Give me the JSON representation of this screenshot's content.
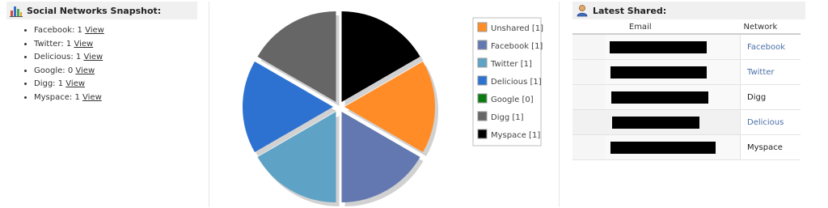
{
  "left_panel": {
    "title": "Social Networks Snapshot:",
    "icon": "bar-chart-icon",
    "items": [
      {
        "name": "Facebook:",
        "count": "1",
        "link": "View"
      },
      {
        "name": "Twitter:",
        "count": "1",
        "link": "View"
      },
      {
        "name": "Delicious:",
        "count": "1",
        "link": "View"
      },
      {
        "name": "Google:",
        "count": "0",
        "link": "View"
      },
      {
        "name": "Digg:",
        "count": "1",
        "link": "View"
      },
      {
        "name": "Myspace:",
        "count": "1",
        "link": "View"
      }
    ]
  },
  "chart_data": {
    "type": "pie",
    "title": "",
    "legend_position": "top-right",
    "series": [
      {
        "name": "Unshared [1]",
        "value": 1,
        "color": "#ff8c26"
      },
      {
        "name": "Facebook [1]",
        "value": 1,
        "color": "#6378b0"
      },
      {
        "name": "Twitter [1]",
        "value": 1,
        "color": "#5ea3c6"
      },
      {
        "name": "Delicious [1]",
        "value": 1,
        "color": "#2e72d1"
      },
      {
        "name": "Google [0]",
        "value": 0,
        "color": "#0a7a12"
      },
      {
        "name": "Digg [1]",
        "value": 1,
        "color": "#666666"
      },
      {
        "name": "Myspace [1]",
        "value": 1,
        "color": "#000000"
      }
    ]
  },
  "right_panel": {
    "title": "Latest Shared:",
    "icon": "user-icon",
    "columns": [
      "Email",
      "Network"
    ],
    "rows": [
      {
        "email": "[redacted]",
        "network": "Facebook",
        "linked": true
      },
      {
        "email": "[redacted]",
        "network": "Twitter",
        "linked": true
      },
      {
        "email": "[redacted]",
        "network": "Digg",
        "linked": false
      },
      {
        "email": "[redacted]",
        "network": "Delicious",
        "linked": true
      },
      {
        "email": "[redacted]",
        "network": "Myspace",
        "linked": false
      }
    ]
  }
}
